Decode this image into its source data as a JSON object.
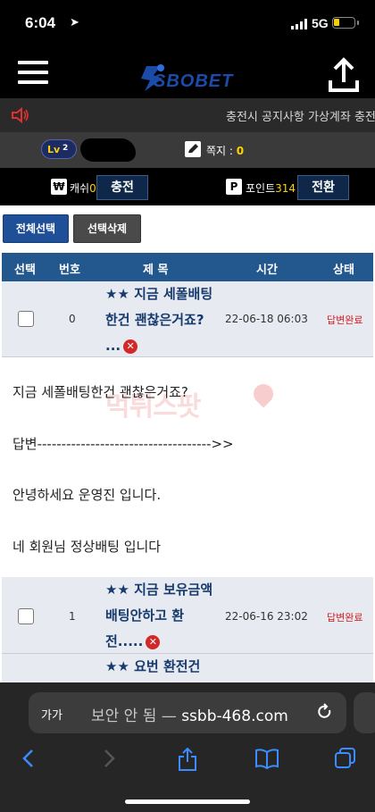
{
  "status_bar": {
    "time": "6:04",
    "network": "5G",
    "battery_level": 0.25
  },
  "header": {
    "logo_text": "SBOBET"
  },
  "notice": {
    "marquee": "충전시 공지사항 가상계좌 충전"
  },
  "user": {
    "level_label": "Lv",
    "level_value": "2",
    "message_label": "쪽지 : ",
    "message_count": "0"
  },
  "wallet": {
    "won_symbol": "₩",
    "cash_label": "캐쉬",
    "cash_value": "0",
    "charge_button": "충전",
    "point_symbol": "P",
    "point_label": "포인트",
    "point_value": "314",
    "exchange_button": "전환"
  },
  "actions": {
    "select_all": "전체선택",
    "delete_selected": "선택삭제"
  },
  "table": {
    "headers": [
      "선택",
      "번호",
      "제 목",
      "시간",
      "상태"
    ],
    "rows": [
      {
        "num": "0",
        "title": "★★ 지금 세폴배팅한건 괜찮은거죠? ...",
        "time": "22-06-18 06:03",
        "status": "답변완료"
      },
      {
        "num": "1",
        "title": "★★ 지금 보유금액 배팅안하고 환전.....",
        "time": "22-06-16 23:02",
        "status": "답변완료"
      },
      {
        "title": "★★ 요번 환전건"
      }
    ]
  },
  "content": {
    "question": "지금 세폴배팅한건 괜찮은거죠?",
    "answer_label": "답변------------------------------------>>",
    "greeting": "안녕하세요 운영진 입니다.",
    "reply": "네 회원님 정상배팅 입니다",
    "watermark": "먹튀스팟"
  },
  "browser": {
    "text_size": "가가",
    "security": "보안 안 됨",
    "url": "ssbb-468.com"
  }
}
